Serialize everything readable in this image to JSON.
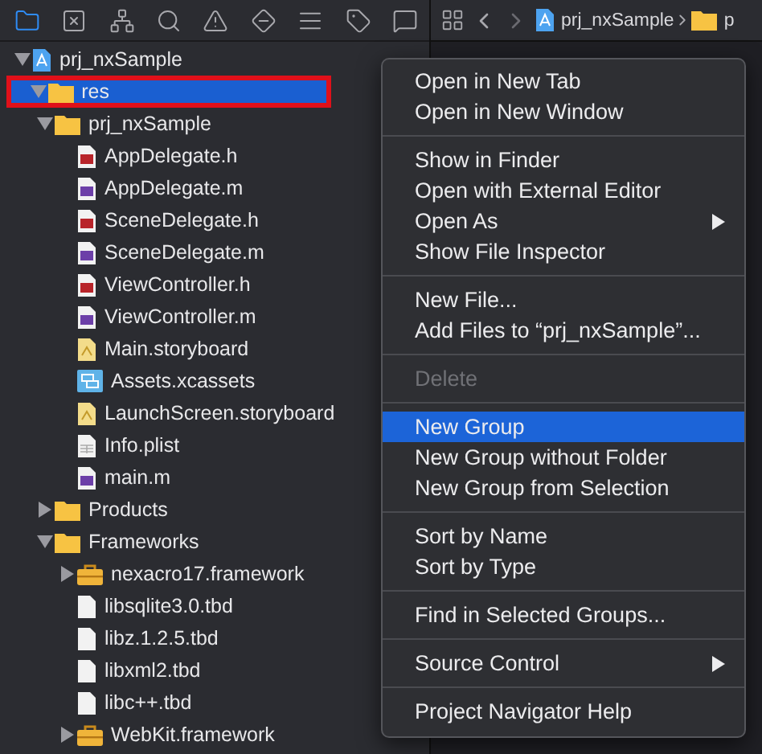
{
  "navigator_tabs": [
    {
      "selected": true
    },
    {
      "selected": false
    },
    {
      "selected": false
    },
    {
      "selected": false
    },
    {
      "selected": false
    },
    {
      "selected": false
    },
    {
      "selected": false
    },
    {
      "selected": false
    },
    {
      "selected": false
    }
  ],
  "tree": [
    {
      "label": "prj_nxSample",
      "kind": "project",
      "expanded": true,
      "selected": false,
      "children": [
        {
          "label": "res",
          "kind": "folder",
          "expanded": true,
          "selected": true,
          "outlined": true
        },
        {
          "label": "prj_nxSample",
          "kind": "folder",
          "expanded": true,
          "selected": false,
          "children": [
            {
              "label": "AppDelegate.h",
              "kind": "header",
              "selected": false
            },
            {
              "label": "AppDelegate.m",
              "kind": "source",
              "selected": false
            },
            {
              "label": "SceneDelegate.h",
              "kind": "header",
              "selected": false
            },
            {
              "label": "SceneDelegate.m",
              "kind": "source",
              "selected": false
            },
            {
              "label": "ViewController.h",
              "kind": "header",
              "selected": false
            },
            {
              "label": "ViewController.m",
              "kind": "source",
              "selected": false
            },
            {
              "label": "Main.storyboard",
              "kind": "storyboard",
              "selected": false
            },
            {
              "label": "Assets.xcassets",
              "kind": "assets",
              "selected": false
            },
            {
              "label": "LaunchScreen.storyboard",
              "kind": "storyboard",
              "selected": false
            },
            {
              "label": "Info.plist",
              "kind": "plist",
              "selected": false
            },
            {
              "label": "main.m",
              "kind": "source",
              "selected": false
            }
          ]
        },
        {
          "label": "Products",
          "kind": "folder",
          "expanded": false,
          "selected": false
        },
        {
          "label": "Frameworks",
          "kind": "folder",
          "expanded": true,
          "selected": false,
          "children": [
            {
              "label": "nexacro17.framework",
              "kind": "framework",
              "expanded": false,
              "selected": false
            },
            {
              "label": "libsqlite3.0.tbd",
              "kind": "tbd",
              "selected": false
            },
            {
              "label": "libz.1.2.5.tbd",
              "kind": "tbd",
              "selected": false
            },
            {
              "label": "libxml2.tbd",
              "kind": "tbd",
              "selected": false
            },
            {
              "label": "libc++.tbd",
              "kind": "tbd",
              "selected": false
            },
            {
              "label": "WebKit.framework",
              "kind": "framework",
              "expanded": false,
              "selected": false
            }
          ]
        }
      ]
    }
  ],
  "breadcrumb": [
    {
      "label": "prj_nxSample",
      "kind": "project"
    },
    {
      "label": "p",
      "kind": "folder"
    }
  ],
  "context_menu": {
    "sections": [
      [
        {
          "label": "Open in New Tab",
          "selected": false,
          "disabled": false,
          "submenu": false
        },
        {
          "label": "Open in New Window",
          "selected": false,
          "disabled": false,
          "submenu": false
        }
      ],
      [
        {
          "label": "Show in Finder",
          "selected": false,
          "disabled": false,
          "submenu": false
        },
        {
          "label": "Open with External Editor",
          "selected": false,
          "disabled": false,
          "submenu": false
        },
        {
          "label": "Open As",
          "selected": false,
          "disabled": false,
          "submenu": true
        },
        {
          "label": "Show File Inspector",
          "selected": false,
          "disabled": false,
          "submenu": false
        }
      ],
      [
        {
          "label": "New File...",
          "selected": false,
          "disabled": false,
          "submenu": false
        },
        {
          "label": "Add Files to “prj_nxSample”...",
          "selected": false,
          "disabled": false,
          "submenu": false
        }
      ],
      [
        {
          "label": "Delete",
          "selected": false,
          "disabled": true,
          "submenu": false
        }
      ],
      [
        {
          "label": "New Group",
          "selected": true,
          "disabled": false,
          "submenu": false
        },
        {
          "label": "New Group without Folder",
          "selected": false,
          "disabled": false,
          "submenu": false
        },
        {
          "label": "New Group from Selection",
          "selected": false,
          "disabled": false,
          "submenu": false
        }
      ],
      [
        {
          "label": "Sort by Name",
          "selected": false,
          "disabled": false,
          "submenu": false
        },
        {
          "label": "Sort by Type",
          "selected": false,
          "disabled": false,
          "submenu": false
        }
      ],
      [
        {
          "label": "Find in Selected Groups...",
          "selected": false,
          "disabled": false,
          "submenu": false
        }
      ],
      [
        {
          "label": "Source Control",
          "selected": false,
          "disabled": false,
          "submenu": true
        }
      ],
      [
        {
          "label": "Project Navigator Help",
          "selected": false,
          "disabled": false,
          "submenu": false
        }
      ]
    ]
  }
}
